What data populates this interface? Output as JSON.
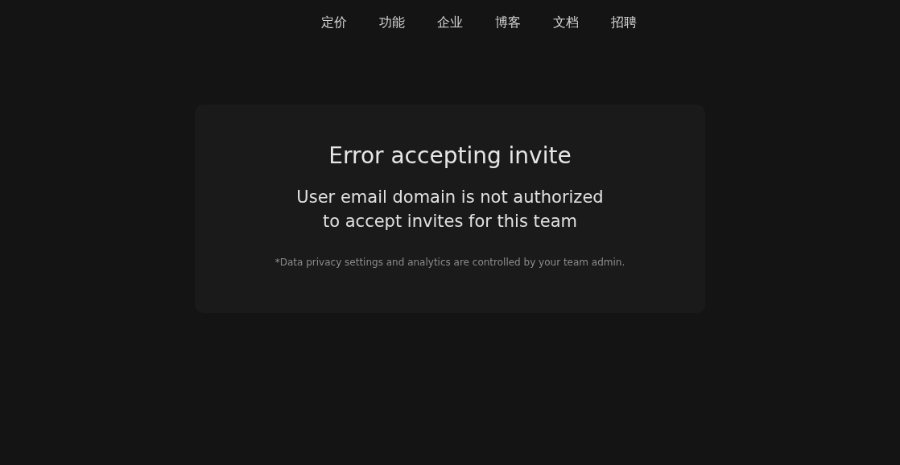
{
  "nav": {
    "items": [
      "定价",
      "功能",
      "企业",
      "博客",
      "文档",
      "招聘"
    ]
  },
  "card": {
    "title": "Error accepting invite",
    "message": "User email domain is not authorized\nto accept invites for this team",
    "note": "*Data privacy settings and analytics are controlled by your team admin."
  }
}
